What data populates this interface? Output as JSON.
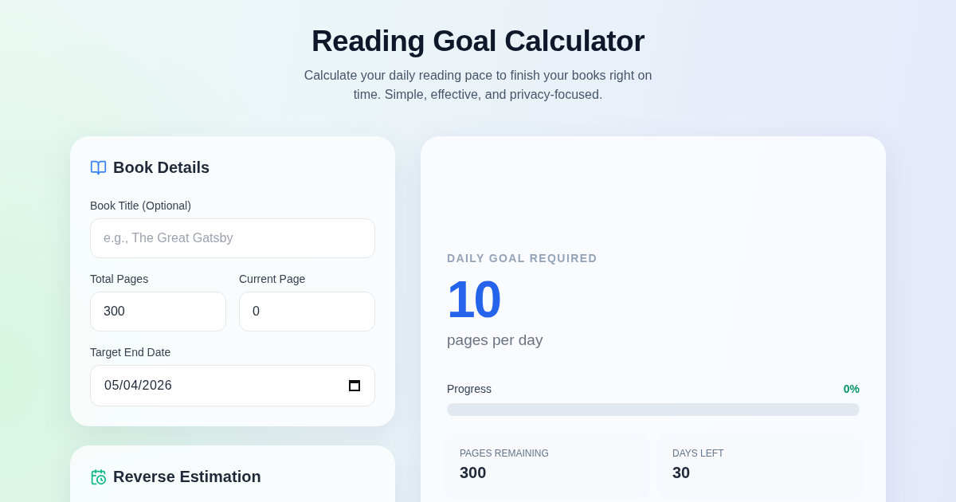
{
  "header": {
    "title": "Reading Goal Calculator",
    "subtitle": "Calculate your daily reading pace to finish your books right on time. Simple, effective, and privacy-focused."
  },
  "book_details": {
    "title": "Book Details",
    "fields": [
      {
        "kind": "text",
        "label": "Book Title (Optional)",
        "placeholder": "e.g., The Great Gatsby"
      },
      {
        "kind": "number",
        "label": "Total Pages",
        "value": "300"
      },
      {
        "kind": "number",
        "label": "Current Page",
        "value": "0"
      },
      {
        "kind": "date",
        "label": "Target End Date",
        "value": "05/04/2026"
      }
    ]
  },
  "reverse_estimation": {
    "title": "Reverse Estimation"
  },
  "result": {
    "caption": "DAILY GOAL REQUIRED",
    "value": "10",
    "unit": "pages per day",
    "progress": {
      "label": "Progress",
      "reading": "0%"
    },
    "stats": [
      {
        "label": "PAGES REMAINING",
        "value": "300"
      },
      {
        "label": "DAYS LEFT",
        "value": "30"
      }
    ]
  }
}
